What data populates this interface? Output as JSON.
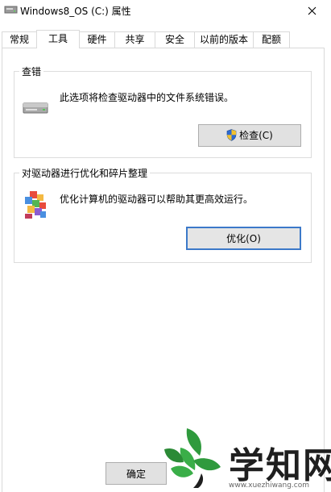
{
  "window": {
    "title": "Windows8_OS (C:) 属性"
  },
  "tabs": [
    {
      "label": "常规"
    },
    {
      "label": "工具"
    },
    {
      "label": "硬件"
    },
    {
      "label": "共享"
    },
    {
      "label": "安全"
    },
    {
      "label": "以前的版本"
    },
    {
      "label": "配额"
    }
  ],
  "check_group": {
    "title": "查错",
    "description": "此选项将检查驱动器中的文件系统错误。",
    "button_label": "检查(C)"
  },
  "optimize_group": {
    "title": "对驱动器进行优化和碎片整理",
    "description": "优化计算机的驱动器可以帮助其更高效运行。",
    "button_label": "优化(O)"
  },
  "footer": {
    "ok_label": "确定"
  },
  "watermark": {
    "text": "学知网",
    "url": "www.xuezhiwang.com"
  },
  "colors": {
    "focus_border": "#3c79c9",
    "button_face": "#e1e1e1",
    "shield_blue": "#2e6ad1",
    "shield_yellow": "#f2c12e"
  }
}
